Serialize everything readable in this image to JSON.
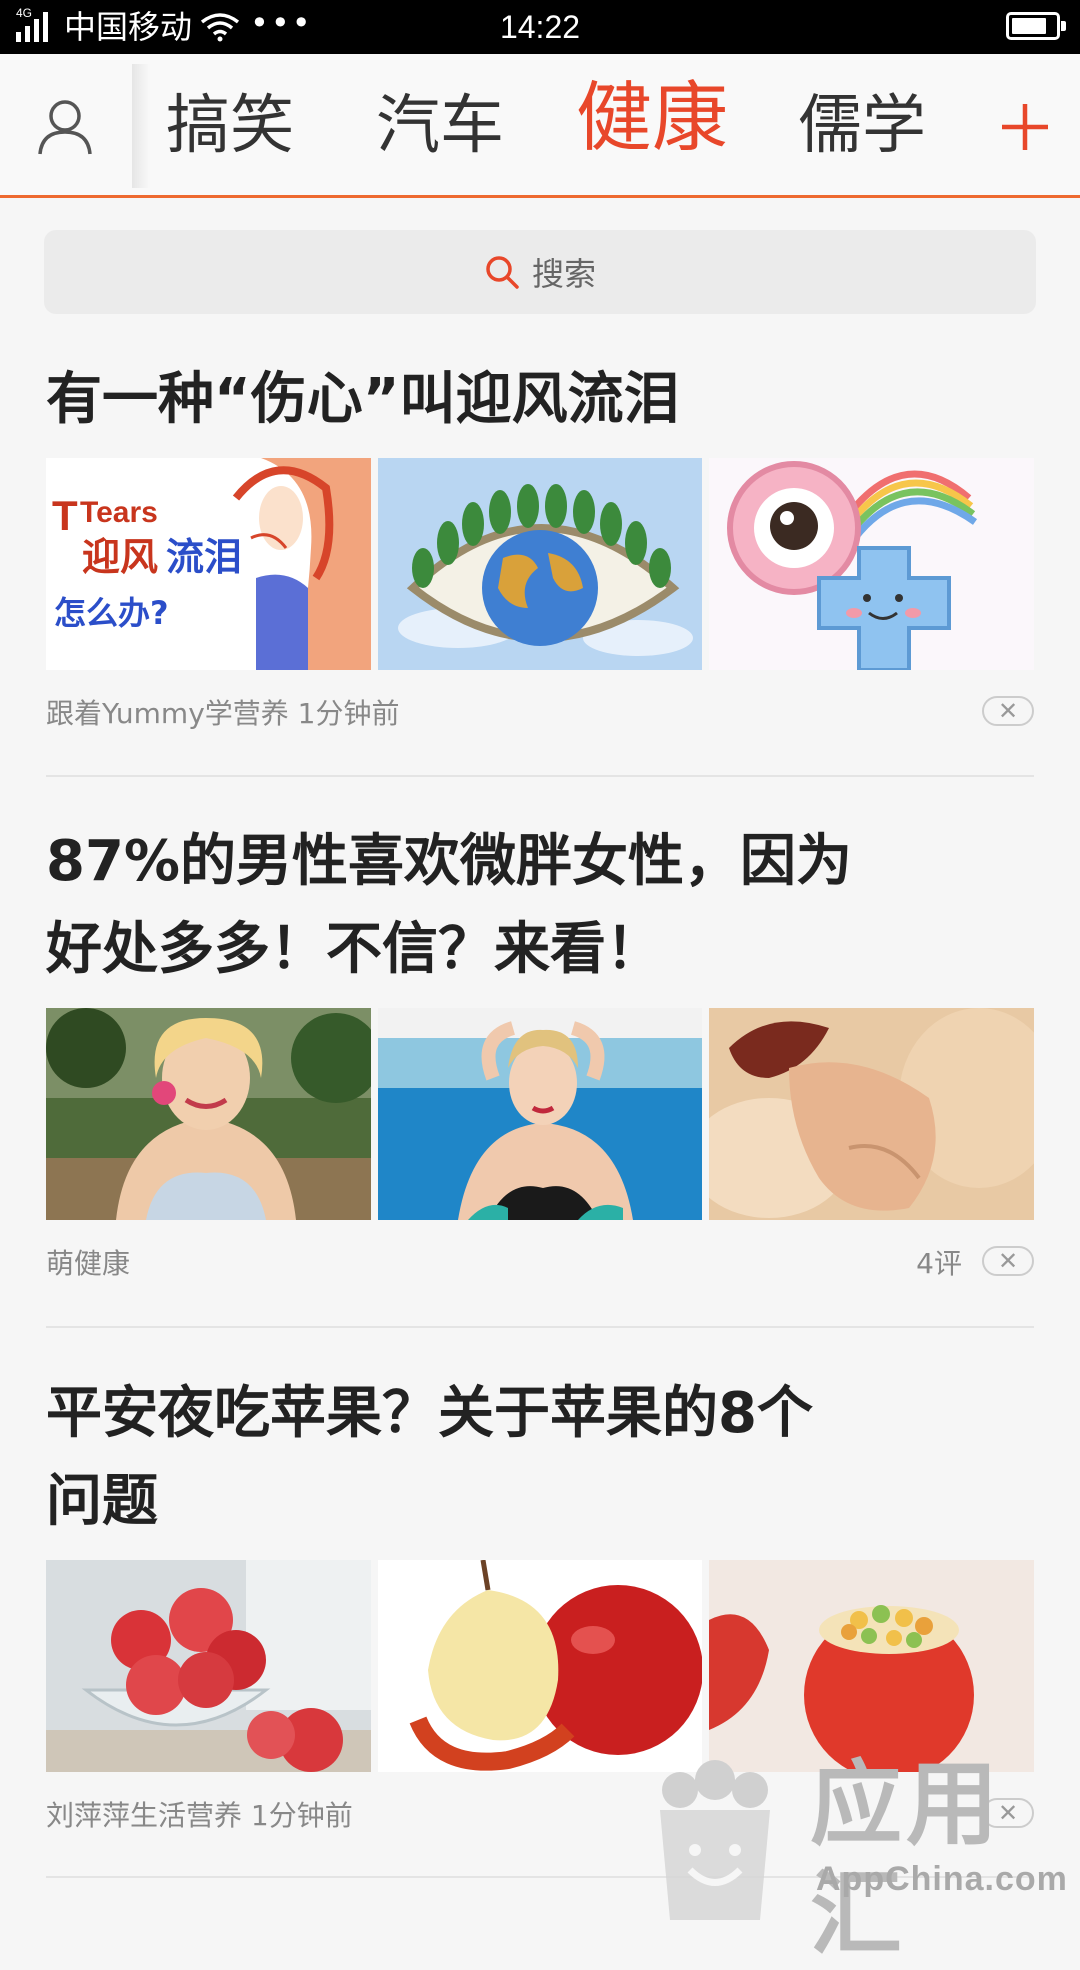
{
  "status_bar": {
    "network": "4G",
    "carrier": "中国移动",
    "dots": "•••",
    "time": "14:22"
  },
  "tabs": {
    "items": [
      "搞笑",
      "汽车",
      "健康",
      "儒学"
    ],
    "active": "健康",
    "accent_color": "#e8472a"
  },
  "search": {
    "placeholder": "搜索"
  },
  "articles": [
    {
      "title": "有一种“伤心”叫迎风流泪",
      "source": "跟着Yummy学营养",
      "time": "1分钟前",
      "comments": "",
      "image_text": {
        "tears": "Tears",
        "line1": "迎风",
        "line1b": "流泪",
        "line2": "怎么办?"
      }
    },
    {
      "title_line1": "87%的男性喜欢微胖女性，因为",
      "title_line2": "好处多多！不信？来看！",
      "source": "萌健康",
      "time": "",
      "comments": "4评"
    },
    {
      "title_line1": "平安夜吃苹果？关于苹果的8个",
      "title_line2": "问题",
      "source": "刘萍萍生活营养",
      "time": "1分钟前",
      "comments": ""
    }
  ],
  "watermark": {
    "title": "应用汇",
    "subtitle": "AppChina.com"
  },
  "icons": {
    "user": "user-icon",
    "add": "plus-icon",
    "search": "search-icon",
    "close": "close-icon"
  }
}
